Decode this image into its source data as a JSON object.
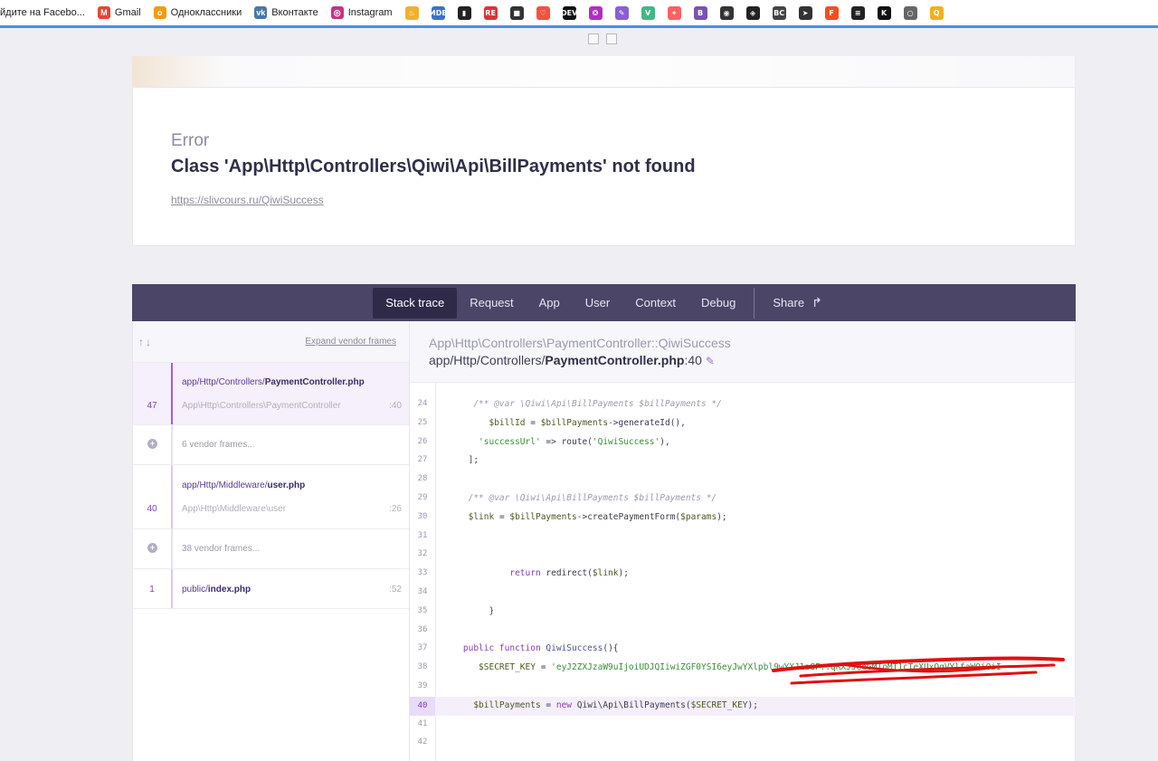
{
  "bookmarks": [
    {
      "label": "йдите на Facebo...",
      "icon": "facebook-icon"
    },
    {
      "label": "Gmail",
      "icon": "gmail-icon",
      "color": "#ea4335",
      "glyph": "M"
    },
    {
      "label": "Одноклассники",
      "icon": "odnoklassniki-icon",
      "color": "#f39c12",
      "glyph": "o"
    },
    {
      "label": "Вконтакте",
      "icon": "vk-icon",
      "color": "#4a76a8",
      "glyph": "vk"
    },
    {
      "label": "Instagram",
      "icon": "instagram-icon",
      "color": "#c13584",
      "glyph": "◎"
    }
  ],
  "bookmark_icons": [
    {
      "name": "lamp-icon",
      "color": "#f0b030",
      "glyph": "♨"
    },
    {
      "name": "mdb-icon",
      "color": "#3b71ca",
      "glyph": "MDB"
    },
    {
      "name": "book-icon",
      "color": "#222222",
      "glyph": "▮"
    },
    {
      "name": "repo-icon",
      "color": "#d33",
      "glyph": "RE"
    },
    {
      "name": "square-icon",
      "color": "#333333",
      "glyph": "■"
    },
    {
      "name": "laravel-icon",
      "color": "#f05340",
      "glyph": "♡"
    },
    {
      "name": "dev-icon",
      "color": "#111111",
      "glyph": "DEV"
    },
    {
      "name": "balloon-icon",
      "color": "#b030c0",
      "glyph": "❂"
    },
    {
      "name": "feather-icon",
      "color": "#8a60d0",
      "glyph": "✎"
    },
    {
      "name": "vue-icon",
      "color": "#41b883",
      "glyph": "V"
    },
    {
      "name": "figma-grid-icon",
      "color": "#ff6060",
      "glyph": "✦"
    },
    {
      "name": "bootstrap-icon",
      "color": "#7952b3",
      "glyph": "B"
    },
    {
      "name": "globe-icon",
      "color": "#333333",
      "glyph": "◉"
    },
    {
      "name": "codepen-icon",
      "color": "#222222",
      "glyph": "◈"
    },
    {
      "name": "bc-icon",
      "color": "#444444",
      "glyph": "BC"
    },
    {
      "name": "telegram-icon",
      "color": "#333333",
      "glyph": "➤"
    },
    {
      "name": "figma-icon",
      "color": "#f24e1e",
      "glyph": "F"
    },
    {
      "name": "layers-icon",
      "color": "#222222",
      "glyph": "≡"
    },
    {
      "name": "k-icon",
      "color": "#111111",
      "glyph": "K"
    },
    {
      "name": "chat-icon",
      "color": "#666666",
      "glyph": "○"
    },
    {
      "name": "q-icon",
      "color": "#f0b020",
      "glyph": "Q"
    }
  ],
  "error": {
    "label": "Error",
    "message": "Class 'App\\Http\\Controllers\\Qiwi\\Api\\BillPayments' not found",
    "url": "https://slivcours.ru/QiwiSuccess"
  },
  "tabs": [
    {
      "label": "Stack trace",
      "active": true
    },
    {
      "label": "Request"
    },
    {
      "label": "App"
    },
    {
      "label": "User"
    },
    {
      "label": "Context"
    },
    {
      "label": "Debug"
    }
  ],
  "share_label": "Share",
  "stack": {
    "expand_label": "Expand vendor frames",
    "frame1": {
      "number": "47",
      "file_prefix": "app/Http/Controllers/",
      "file_name": "PaymentController.php",
      "class": "App\\Http\\Controllers\\PaymentController",
      "line": ":40"
    },
    "vendor1": "6 vendor frames...",
    "frame2": {
      "number": "40",
      "file_prefix": "app/Http/Middleware/",
      "file_name": "user.php",
      "class": "App\\Http\\Middleware\\user",
      "line": ":26"
    },
    "vendor2": "38 vendor frames...",
    "frame3": {
      "number": "1",
      "file_prefix": "public/",
      "file_name": "index.php",
      "line": ":52"
    }
  },
  "code": {
    "method": "App\\Http\\Controllers\\PaymentController::QiwiSuccess",
    "path_prefix": "app/Http/Controllers/",
    "path_file": "PaymentController.php",
    "path_line": ":40",
    "lines": [
      {
        "n": "24",
        "html": "      <span class='cm'>/** @var \\Qiwi\\Api\\BillPayments $billPayments */</span>"
      },
      {
        "n": "25",
        "html": "         <span class='var'>$billId</span> = <span class='var'>$billPayments</span>-&gt;generateId(),"
      },
      {
        "n": "26",
        "html": "       <span class='str'>'successUrl'</span> =&gt; route(<span class='str'>'QiwiSuccess'</span>),"
      },
      {
        "n": "27",
        "html": "     ];"
      },
      {
        "n": "28",
        "html": ""
      },
      {
        "n": "29",
        "html": "     <span class='cm'>/** @var \\Qiwi\\Api\\BillPayments $billPayments */</span>"
      },
      {
        "n": "30",
        "html": "     <span class='var'>$link</span> = <span class='var'>$billPayments</span>-&gt;createPaymentForm(<span class='var'>$params</span>);"
      },
      {
        "n": "31",
        "html": ""
      },
      {
        "n": "32",
        "html": ""
      },
      {
        "n": "33",
        "html": "             <span class='kw'>return</span> redirect(<span class='var'>$link</span>);"
      },
      {
        "n": "34",
        "html": ""
      },
      {
        "n": "35",
        "html": "         }"
      },
      {
        "n": "36",
        "html": ""
      },
      {
        "n": "37",
        "html": "    <span class='kw'>public function</span> <span class='fn'>QiwiSuccess</span>(){"
      },
      {
        "n": "38",
        "html": "       <span class='var'>$SECRET_KEY</span> = <span class='str'>'eyJ2ZXJzaW9uIjoiUDJQIiwiZGF0YSI6eyJwYXlpbl9wYXJ1aGF..qRXJJeeGMIoMT1cTeXUxQgVYlfaWQiOiI</span>"
      },
      {
        "n": "39",
        "html": ""
      },
      {
        "n": "40",
        "html": "      <span class='var'>$billPayments</span> = <span class='kw'>new</span> Qiwi\\Api\\BillPayments(<span class='var'>$SECRET_KEY</span>);",
        "highlight": true
      },
      {
        "n": "41",
        "html": ""
      },
      {
        "n": "42",
        "html": ""
      }
    ]
  }
}
